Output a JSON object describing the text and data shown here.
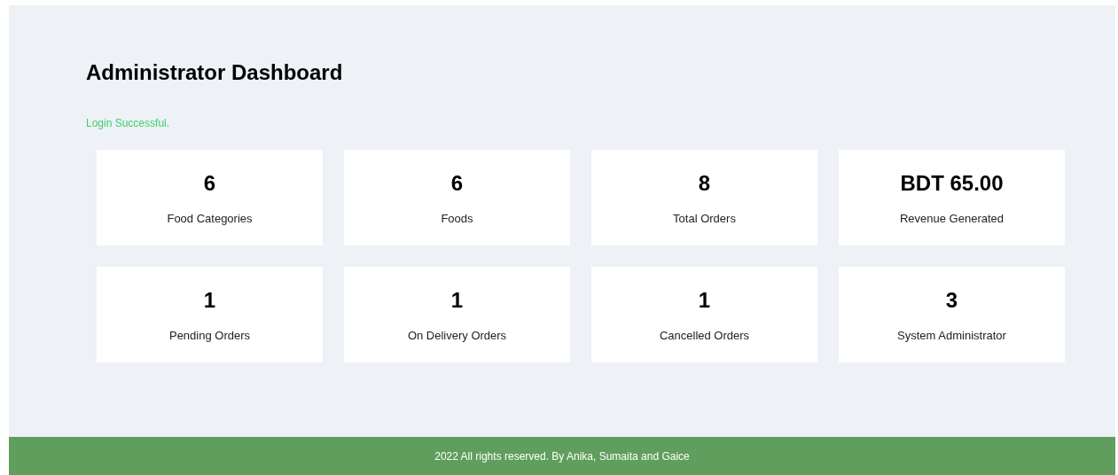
{
  "title": "Administrator Dashboard",
  "message": "Login Successful.",
  "stats": [
    {
      "value": "6",
      "label": "Food Categories"
    },
    {
      "value": "6",
      "label": "Foods"
    },
    {
      "value": "8",
      "label": "Total Orders"
    },
    {
      "value": "BDT 65.00",
      "label": "Revenue Generated"
    },
    {
      "value": "1",
      "label": "Pending Orders"
    },
    {
      "value": "1",
      "label": "On Delivery Orders"
    },
    {
      "value": "1",
      "label": "Cancelled Orders"
    },
    {
      "value": "3",
      "label": "System Administrator"
    }
  ],
  "footer": "2022 All rights reserved. By Anika, Sumaita and Gaice"
}
